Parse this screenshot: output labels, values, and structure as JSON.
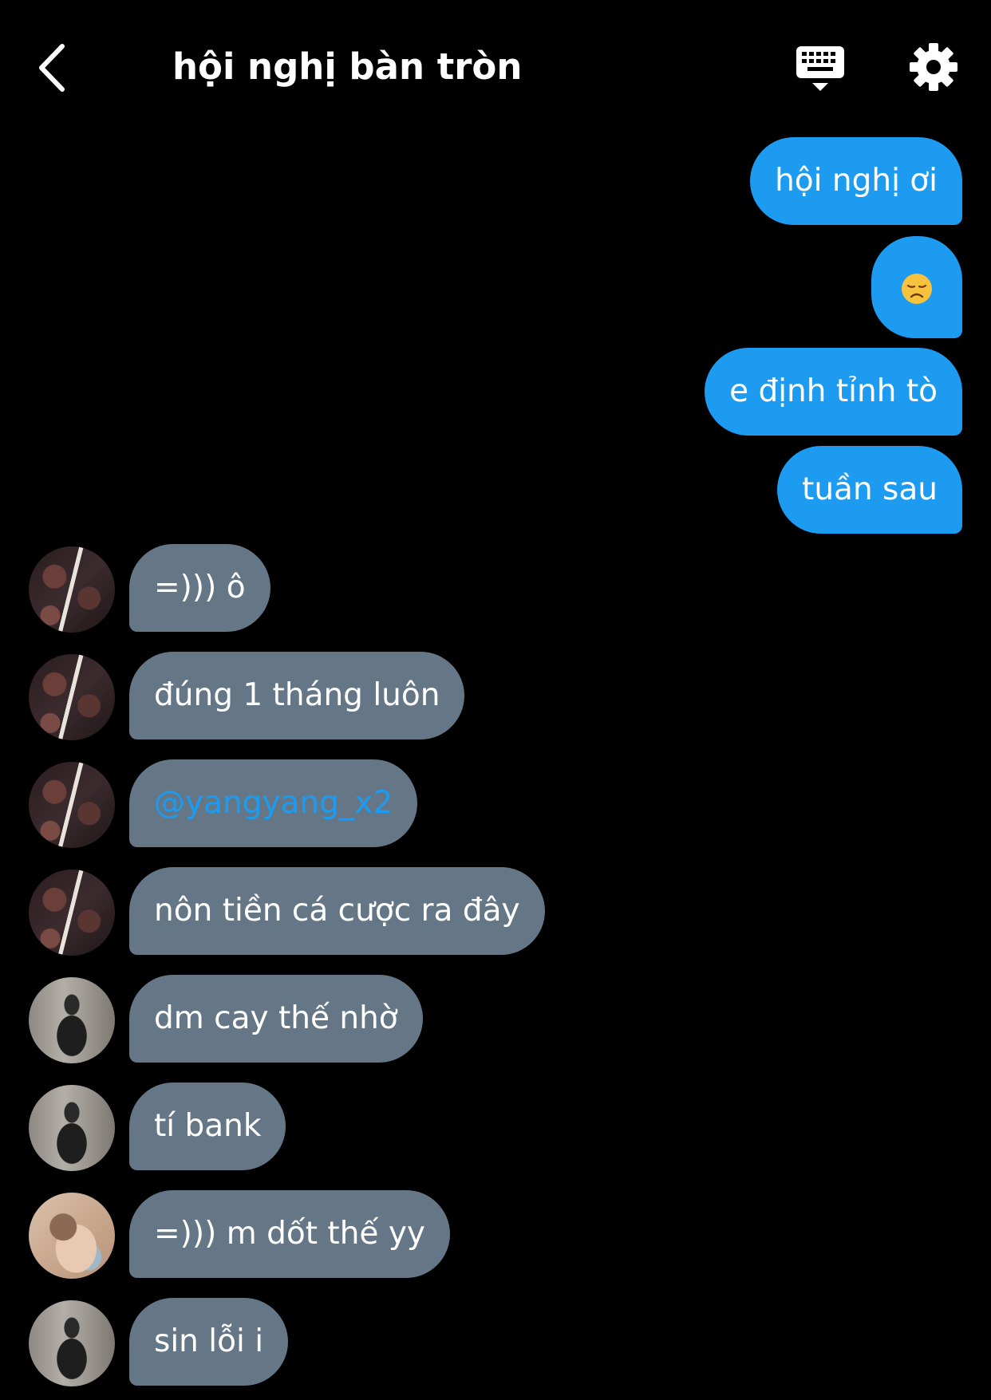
{
  "header": {
    "title": "hội nghị bàn tròn",
    "back_icon": "chevron-left-icon",
    "keyboard_icon": "keyboard-icon",
    "settings_icon": "gear-icon"
  },
  "colors": {
    "background": "#000000",
    "outgoing_bubble": "#1d9bf0",
    "incoming_bubble": "#657786",
    "mention": "#1d9bf0",
    "text": "#ffffff"
  },
  "messages": [
    {
      "direction": "outgoing",
      "text": "hội nghị ơi"
    },
    {
      "direction": "outgoing",
      "emoji": "disappointed-face-emoji"
    },
    {
      "direction": "outgoing",
      "text": "e định tỉnh tò"
    },
    {
      "direction": "outgoing",
      "text": "tuần sau"
    },
    {
      "direction": "incoming",
      "text": "=))) ô"
    },
    {
      "direction": "incoming",
      "text": "đúng 1 tháng luôn"
    },
    {
      "direction": "incoming",
      "text": "@yangyang_x2",
      "mention": true
    },
    {
      "direction": "incoming",
      "text": "nôn tiền cá cược ra đây"
    },
    {
      "direction": "incoming",
      "text": "dm cay thế nhờ"
    },
    {
      "direction": "incoming",
      "text": "tí bank"
    },
    {
      "direction": "incoming",
      "text": "=))) m dốt thế yy"
    },
    {
      "direction": "incoming",
      "text": "sin lỗi i"
    }
  ]
}
